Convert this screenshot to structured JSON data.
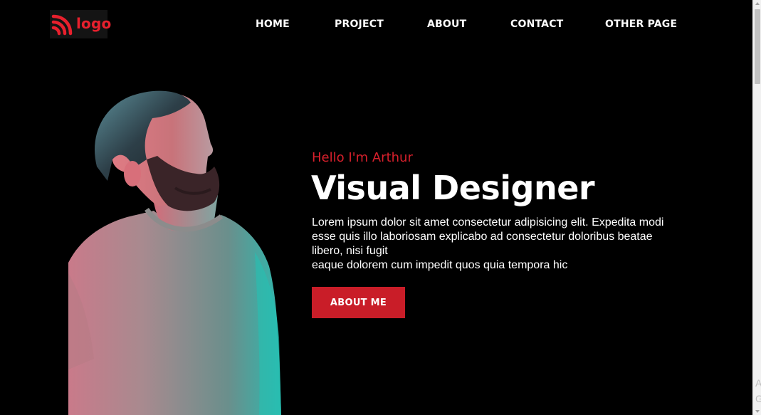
{
  "header": {
    "logo_text": "logo",
    "logo_icon": "rss-icon",
    "nav": [
      {
        "label": "HOME"
      },
      {
        "label": "PROJECT"
      },
      {
        "label": "ABOUT"
      },
      {
        "label": "CONTACT"
      },
      {
        "label": "OTHER PAGE"
      }
    ]
  },
  "hero": {
    "greeting": "Hello I'm Arthur",
    "title": "Visual Designer",
    "description_lines": [
      "Lorem ipsum dolor sit amet consectetur adipisicing elit. Expedita modi",
      "esse quis illo laboriosam explicabo ad consectetur doloribus beatae",
      "libero, nisi fugit",
      "eaque dolorem cum impedit quos quia tempora hic"
    ],
    "cta_label": "ABOUT ME"
  },
  "corner": {
    "partial_text": "A G"
  },
  "colors": {
    "background": "#000000",
    "accent": "#d8202c",
    "button": "#c91d28",
    "text": "#ffffff"
  }
}
